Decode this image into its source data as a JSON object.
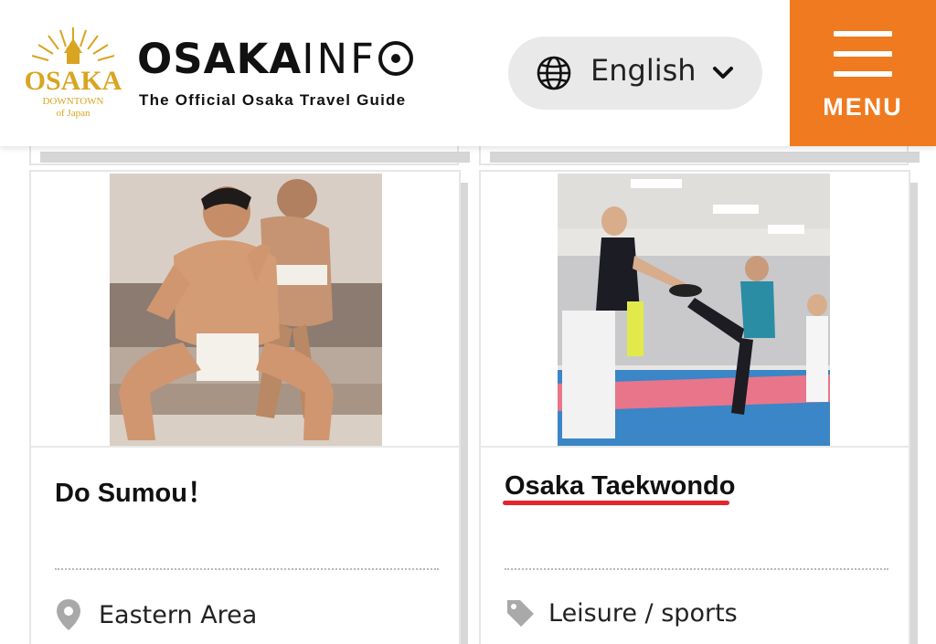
{
  "header": {
    "logo_seal": {
      "main": "OSAKA",
      "line1": "DOWNTOWN",
      "line2": "of Japan"
    },
    "logo_word_bold": "OSAKA",
    "logo_word_thin": "INF",
    "tagline": "The Official Osaka Travel Guide",
    "language": {
      "label": "English",
      "icon": "globe-icon"
    },
    "menu": {
      "label": "MENU",
      "icon": "hamburger-icon"
    }
  },
  "colors": {
    "accent": "#ef7a1f",
    "pill_bg": "#e9e9e9",
    "underline": "#e4242e",
    "logo_gold": "#d9a521"
  },
  "cards": [
    {
      "title": "Do Sumou！",
      "meta_icon": "location-pin-icon",
      "meta_text": "Eastern Area"
    },
    {
      "title": "Osaka Taekwondo",
      "meta_icon": "tag-icon",
      "meta_text": "Leisure / sports"
    }
  ]
}
